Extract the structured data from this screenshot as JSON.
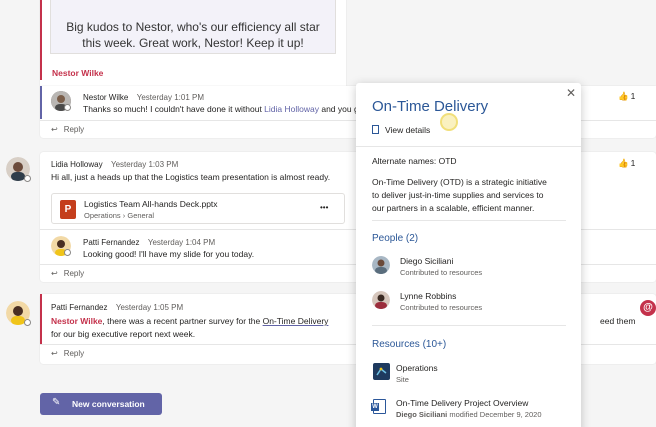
{
  "kudos": {
    "line1": "Big kudos to Nestor, who's our efficiency all star",
    "line2": "this week. Great work, Nestor! Keep it up!",
    "author": "Nestor Wilke"
  },
  "thread1": {
    "reply_msg": {
      "author": "Nestor Wilke",
      "time": "Yesterday 1:01 PM",
      "text_before": "Thanks so much! I couldn't have done it without ",
      "link": "Lidia Holloway",
      "text_after": " and you guys",
      "reaction": "1"
    },
    "reply_label": "Reply"
  },
  "thread2": {
    "post": {
      "author": "Lidia Holloway",
      "time": "Yesterday 1:03 PM",
      "text": "Hi all, just a heads up that the Logistics team presentation is almost ready.",
      "reaction": "1"
    },
    "file": {
      "name": "Logistics Team All-hands Deck.pptx",
      "path_team": "Operations",
      "path_channel": "General",
      "more": "•••"
    },
    "reply_msg": {
      "author": "Patti Fernandez",
      "time": "Yesterday 1:04 PM",
      "text": "Looking good! I'll have my slide for you today."
    },
    "reply_label": "Reply"
  },
  "thread3": {
    "post": {
      "author": "Patti Fernandez",
      "time": "Yesterday 1:05 PM",
      "mention": "Nestor Wilke",
      "text_before": ", there was a recent partner survey for the ",
      "term": "On-Time Delivery",
      "text_tail": "eed them",
      "line2": "for our big executive report next week."
    },
    "reply_label": "Reply"
  },
  "new_conversation": "New conversation",
  "popup": {
    "title": "On-Time Delivery",
    "view_details": "View details",
    "alternate_names": "Alternate names: OTD",
    "description_lines": [
      "On-Time Delivery (OTD) is a strategic initiative",
      "to deliver just-in-time supplies and services to",
      "our partners in a scalable, efficient manner."
    ],
    "people_title": "People (2)",
    "people": [
      {
        "name": "Diego Siciliani",
        "sub": "Contributed to resources"
      },
      {
        "name": "Lynne Robbins",
        "sub": "Contributed to resources"
      }
    ],
    "resources_title": "Resources (10+)",
    "resources": [
      {
        "name": "Operations",
        "sub": "Site"
      },
      {
        "name": "On-Time Delivery Project Overview",
        "sub_author": "Diego Siciliani",
        "sub_rest": " modified December 9, 2020"
      }
    ]
  },
  "colors": {
    "accent": "#6264a7",
    "mention": "#c4314b",
    "popup_title": "#2b5797",
    "button": "#6264a7"
  }
}
